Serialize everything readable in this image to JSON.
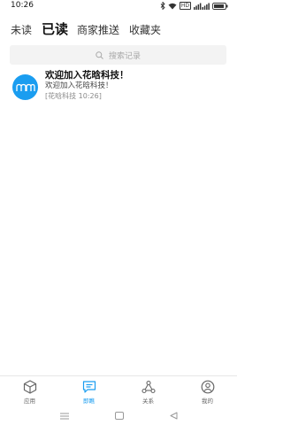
{
  "status_bar": {
    "time": "10:26",
    "hd_badge": "HD",
    "icons": [
      "bluetooth-icon",
      "wifi-icon",
      "signal-icon",
      "battery-icon"
    ]
  },
  "tabs": [
    {
      "label": "未读",
      "active": false
    },
    {
      "label": "已读",
      "active": true
    },
    {
      "label": "商家推送",
      "active": false
    },
    {
      "label": "收藏夹",
      "active": false
    }
  ],
  "search": {
    "placeholder": "搜索记录",
    "icon": "search-icon"
  },
  "messages": [
    {
      "title": "欢迎加入花晗科技！",
      "preview": "欢迎加入花晗科技！",
      "meta": "[花晗科技 10:26]",
      "avatar_icon": "logo-icon"
    }
  ],
  "bottom_nav": [
    {
      "label": "应用",
      "icon": "box-icon",
      "active": false
    },
    {
      "label": "即瞧",
      "icon": "chat-icon",
      "active": true
    },
    {
      "label": "关系",
      "icon": "share-network-icon",
      "active": false
    },
    {
      "label": "我的",
      "icon": "user-icon",
      "active": false
    }
  ],
  "system_nav": [
    "menu-icon",
    "home-icon",
    "back-icon"
  ],
  "colors": {
    "accent": "#1a9df0",
    "inactive": "#666666",
    "search_bg": "#f3f3f3"
  }
}
